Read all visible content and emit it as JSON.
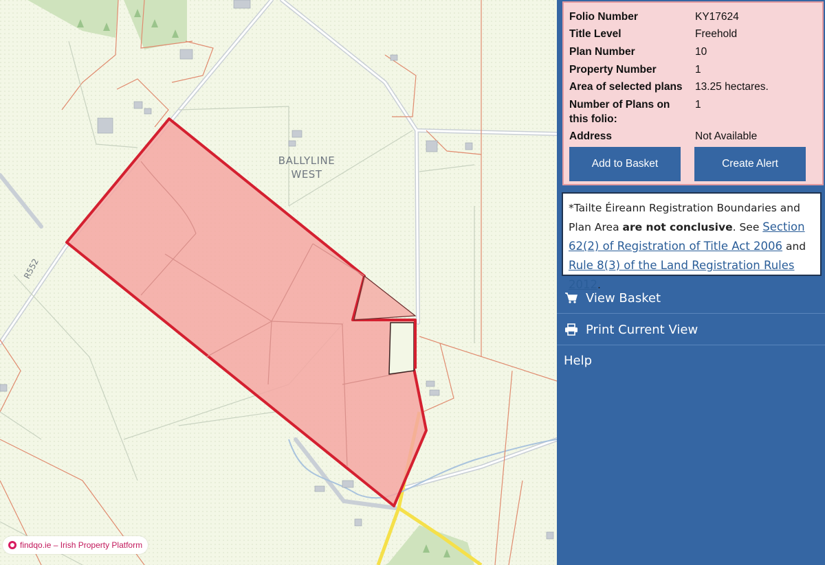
{
  "map": {
    "place_label_line1": "BALLYLINE",
    "place_label_line2": "WEST",
    "road_label": "R552",
    "watermark": "findqo.ie – Irish Property Platform",
    "parcel_fill": "#f4a7a2",
    "parcel_outline": "#d42030"
  },
  "folio": {
    "rows": [
      {
        "key": "Folio Number",
        "value": "KY17624"
      },
      {
        "key": "Title Level",
        "value": "Freehold"
      },
      {
        "key": "Plan Number",
        "value": "10"
      },
      {
        "key": "Property Number",
        "value": "1"
      },
      {
        "key": "Area of selected plans",
        "value": "13.25 hectares."
      },
      {
        "key": "Number of Plans on this folio:",
        "value": "1"
      },
      {
        "key": "Address",
        "value": "Not Available"
      }
    ],
    "add_to_basket": "Add to Basket",
    "create_alert": "Create Alert"
  },
  "notice": {
    "text_a": "*Tailte Éireann Registration Boundaries and Plan Area",
    "text_bold": "are not conclusive",
    "text_b": ". See",
    "link1": "Section 62(2) of Registration of Title Act 2006",
    "text_c": "and",
    "link2": "Rule 8(3) of the Land Registration Rules 2012",
    "text_d": "."
  },
  "menu": {
    "view_basket": "View Basket",
    "print_view": "Print Current View",
    "help": "Help"
  }
}
